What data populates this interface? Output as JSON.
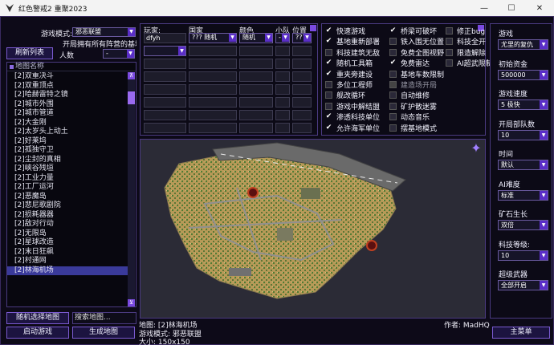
{
  "window": {
    "title": "红色警戒2 重聚2023",
    "minimize": "—",
    "maximize": "☐",
    "close": "✕"
  },
  "left": {
    "mode_label": "游戏模式:",
    "mode_value": "邪恶联盟",
    "bases_text": "开局拥有所有阵营的基地车",
    "refresh_button": "刷新列表",
    "players_label": "人数",
    "players_value": "-",
    "list_header": "地图名称",
    "maps": [
      "[2]双重决斗",
      "[2]双重顶点",
      "[2]哈赫雷特之镜",
      "[2]城市外围",
      "[2]城市管道",
      "[2]大金刚",
      "[2]太岁头上动土",
      "[2]好莱坞",
      "[2]孤独守卫",
      "[2]尘封的真相",
      "[2]峡谷残垣",
      "[2]工业力量",
      "[2]工厂运河",
      "[2]恶魔岛",
      "[2]悲尼歌剧院",
      "[2]损耗器器",
      "[2]敌对行动",
      "[2]无限岛",
      "[2]星球改造",
      "[2]末日狂飙",
      "[2]村通网",
      "[2]林海机场"
    ],
    "selected_map": "[2]林海机场",
    "random_button": "随机选择地图",
    "search_placeholder": "搜索地图...",
    "start_button": "启动游戏",
    "generate_button": "生成地图"
  },
  "players": {
    "headers": {
      "player": "玩家:",
      "country": "国家",
      "color": "颜色",
      "team": "小队",
      "pos": "位置"
    },
    "row1": {
      "player": "dfyh",
      "country": "??? 随机",
      "color": "随机",
      "team": "-",
      "pos": "???"
    }
  },
  "options": {
    "col1": [
      {
        "label": "快速游戏",
        "checked": true
      },
      {
        "label": "基地重新部署",
        "checked": true
      },
      {
        "label": "科技建筑无敌",
        "checked": false
      },
      {
        "label": "随机工具箱",
        "checked": true
      },
      {
        "label": "重夹旁建设",
        "checked": true
      },
      {
        "label": "多位工程师",
        "checked": false
      },
      {
        "label": "舰改循环",
        "checked": false
      },
      {
        "label": "游戏中解结盟",
        "checked": false
      },
      {
        "label": "渗透科技单位",
        "checked": true
      },
      {
        "label": "允许海军单位",
        "checked": true
      }
    ],
    "col2": [
      {
        "label": "桥梁可破坏",
        "checked": true
      },
      {
        "label": "铁入围无位置",
        "checked": false
      },
      {
        "label": "免费全图视野",
        "checked": false
      },
      {
        "label": "免费雷达",
        "checked": true
      },
      {
        "label": "基地车数限制",
        "checked": false
      },
      {
        "label": "建造场开局",
        "checked": false,
        "disabled": true
      },
      {
        "label": "自动维修",
        "checked": false
      },
      {
        "label": "矿护散迷雾",
        "checked": false
      },
      {
        "label": "动态音乐",
        "checked": false
      },
      {
        "label": "摆基地模式",
        "checked": false
      }
    ],
    "col3": [
      {
        "label": "修正bug",
        "checked": false
      },
      {
        "label": "科技全开",
        "checked": false
      },
      {
        "label": "限造解除",
        "checked": false
      },
      {
        "label": "AI超武限制",
        "checked": false
      }
    ]
  },
  "map_info": {
    "map_line": "地图: [2]林海机场",
    "mode_line": "游戏模式: 邪恶联盟",
    "size_line": "大小: 150x150",
    "author_line": "作者: MadHQ"
  },
  "settings": [
    {
      "label": "游戏",
      "value": "尤里的复仇"
    },
    {
      "label": "初始资金",
      "value": "500000"
    },
    {
      "label": "游戏速度",
      "value": "5 极快"
    },
    {
      "label": "开局部队数",
      "value": "10"
    },
    {
      "label": "时间",
      "value": "默认"
    },
    {
      "label": "AI难度",
      "value": "标准"
    },
    {
      "label": "矿石生长",
      "value": "双倍"
    },
    {
      "label": "科技等级:",
      "value": "10"
    },
    {
      "label": "超级武器",
      "value": "全部开启"
    }
  ],
  "main_menu_button": "主菜单",
  "colors": {
    "accent": "#5a2ec8",
    "border": "#5a3aa0",
    "panel": "#0c0a16"
  }
}
